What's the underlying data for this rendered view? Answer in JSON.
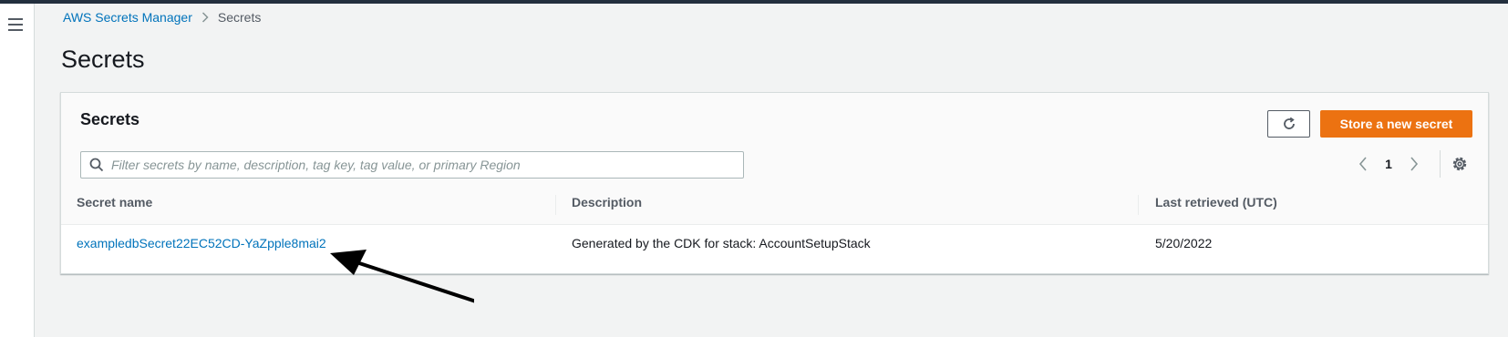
{
  "breadcrumb": {
    "service": "AWS Secrets Manager",
    "current": "Secrets"
  },
  "page": {
    "title": "Secrets"
  },
  "panel": {
    "title": "Secrets",
    "refresh_icon": "refresh-icon",
    "primary_action": "Store a new secret",
    "search": {
      "placeholder": "Filter secrets by name, description, tag key, tag value, or primary Region",
      "value": ""
    },
    "pagination": {
      "current_page": "1"
    },
    "settings_icon": "gear-icon"
  },
  "table": {
    "columns": [
      "Secret name",
      "Description",
      "Last retrieved (UTC)"
    ],
    "rows": [
      {
        "name": "exampledbSecret22EC52CD-YaZpple8mai2",
        "description": "Generated by the CDK for stack: AccountSetupStack",
        "last_retrieved": "5/20/2022"
      }
    ]
  },
  "colors": {
    "link": "#0073bb",
    "primary_button": "#ec7211",
    "top_bar": "#232f3e"
  }
}
